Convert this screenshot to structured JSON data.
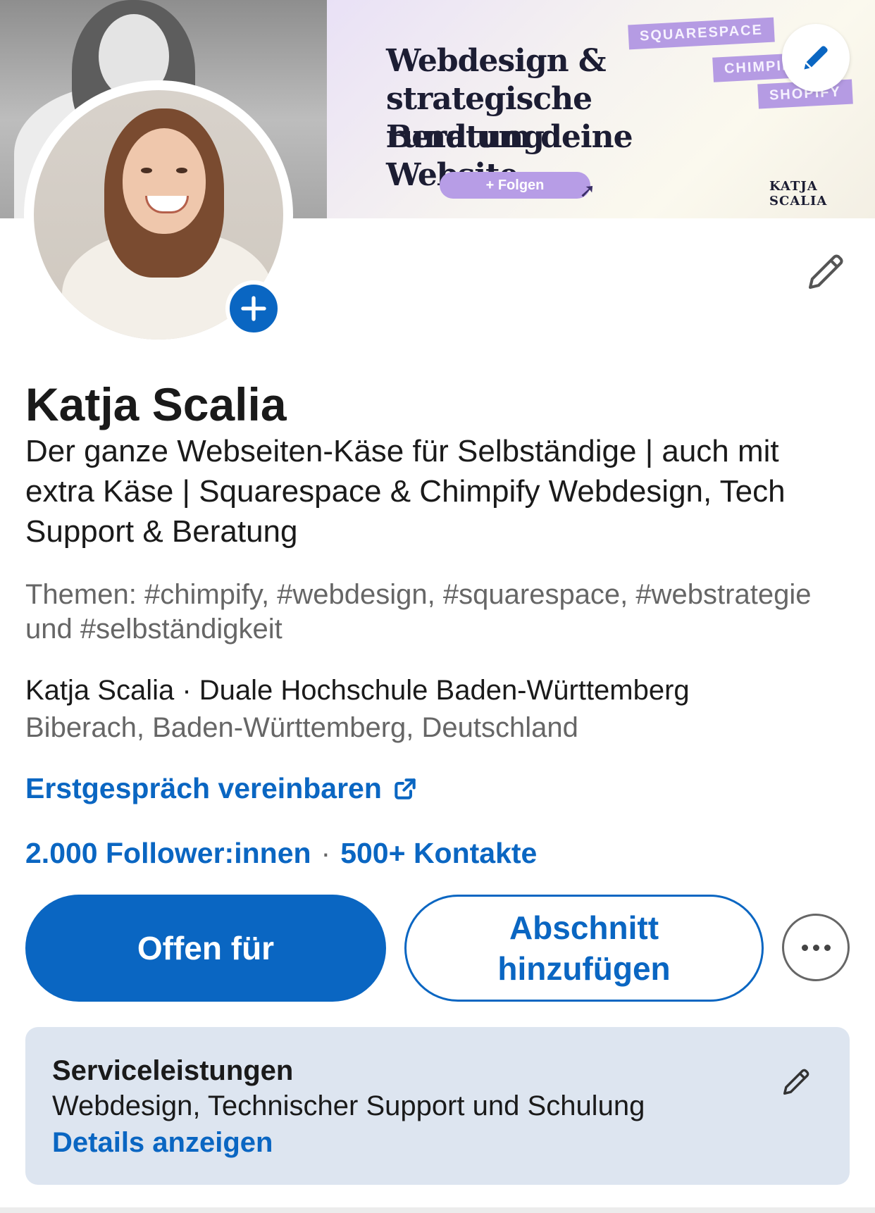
{
  "banner": {
    "headline_lines": [
      "Webdesign &",
      "strategische Beratung",
      "rund um deine Website."
    ],
    "follow_label": "+ Folgen",
    "tags": [
      "SQUARESPACE",
      "CHIMPIFY",
      "SHOPIFY"
    ],
    "brand": "KATJA SCALIA",
    "accent_color": "#b59be3"
  },
  "profile": {
    "name": "Katja Scalia",
    "headline": "Der ganze Webseiten-Käse für Selbständige | auch mit extra Käse | Squarespace & Chimpify Webdesign, Tech Support & Beratung",
    "topics": "Themen: #chimpify, #webdesign, #squarespace, #webstrategie und #selbständigkeit",
    "education_line": "Katja Scalia · Duale Hochschule Baden-Württemberg",
    "location": "Biberach, Baden-Württemberg, Deutschland",
    "link_label": "Erstgespräch vereinbaren",
    "followers": "2.000 Follower:innen",
    "separator": "·",
    "connections": "500+ Kontakte"
  },
  "actions": {
    "open_to": "Offen für",
    "add_section": "Abschnitt hinzufügen",
    "more_icon": "more-horizontal-icon"
  },
  "services": {
    "title": "Serviceleistungen",
    "list": "Webdesign, Technischer Support und Schulung",
    "details": "Details anzeigen"
  },
  "colors": {
    "primary": "#0a66c2",
    "text": "#1a1a1a",
    "muted": "#666666",
    "card_bg": "#dde5f0"
  },
  "icons": {
    "banner_edit": "pencil-icon",
    "intro_edit": "pencil-icon",
    "avatar_add": "plus-icon",
    "link": "external-link-icon",
    "services_edit": "pencil-icon"
  }
}
